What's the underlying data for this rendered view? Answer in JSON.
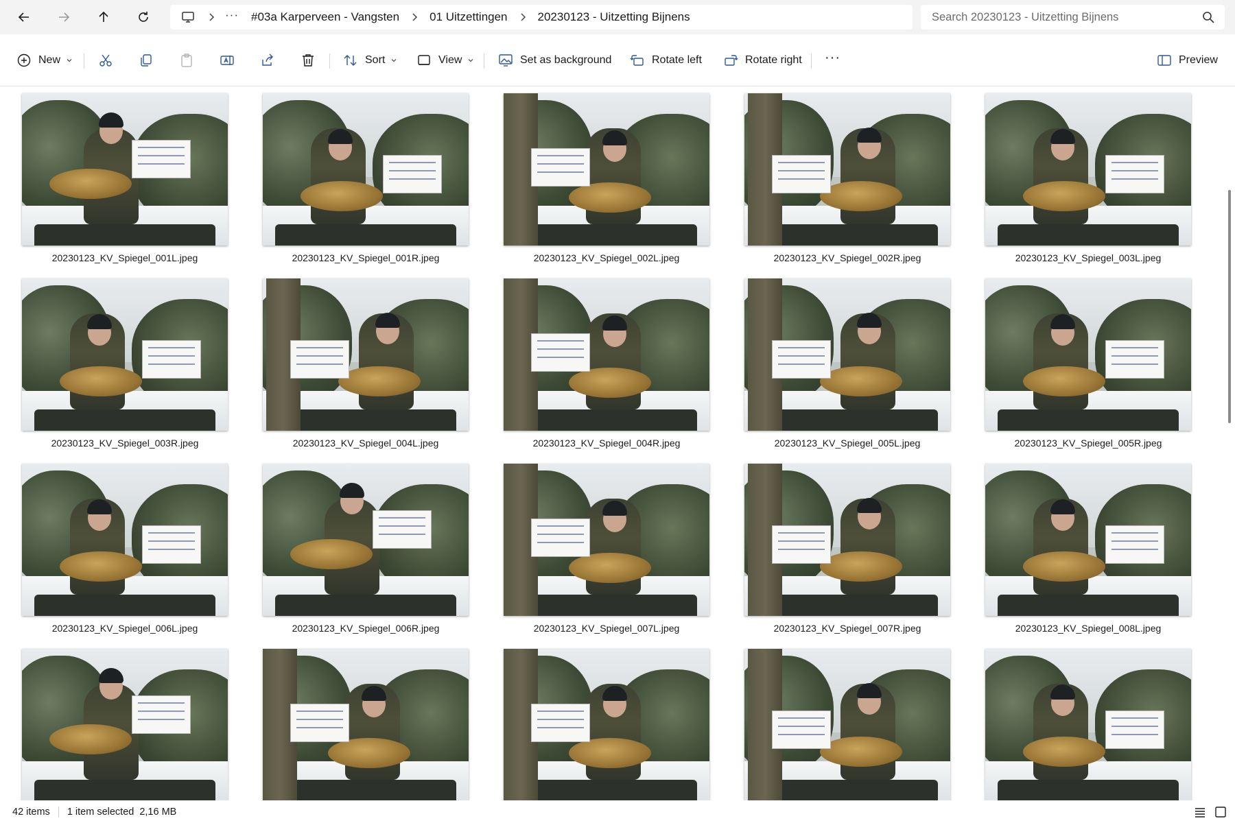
{
  "nav": {
    "back_icon": "back-arrow-icon",
    "forward_icon": "forward-arrow-icon",
    "up_icon": "up-arrow-icon",
    "refresh_icon": "refresh-icon"
  },
  "breadcrumb": {
    "location_icon": "monitor-icon",
    "more": "···",
    "items": [
      "#03a Karperveen - Vangsten",
      "01 Uitzettingen",
      "20230123 - Uitzetting Bijnens"
    ]
  },
  "search": {
    "placeholder": "Search 20230123 - Uitzetting Bijnens"
  },
  "toolbar": {
    "new_label": "New",
    "sort_label": "Sort",
    "view_label": "View",
    "set_background_label": "Set as background",
    "rotate_left_label": "Rotate left",
    "rotate_right_label": "Rotate right",
    "more_label": "···",
    "preview_label": "Preview"
  },
  "files": [
    {
      "name": "20230123_KV_Spiegel_001L.jpeg",
      "variant": "vA"
    },
    {
      "name": "20230123_KV_Spiegel_001R.jpeg",
      "variant": "vB"
    },
    {
      "name": "20230123_KV_Spiegel_002L.jpeg",
      "variant": "vC"
    },
    {
      "name": "20230123_KV_Spiegel_002R.jpeg",
      "variant": "vD"
    },
    {
      "name": "20230123_KV_Spiegel_003L.jpeg",
      "variant": "vB"
    },
    {
      "name": "20230123_KV_Spiegel_003R.jpeg",
      "variant": "vB"
    },
    {
      "name": "20230123_KV_Spiegel_004L.jpeg",
      "variant": "vD"
    },
    {
      "name": "20230123_KV_Spiegel_004R.jpeg",
      "variant": "vC"
    },
    {
      "name": "20230123_KV_Spiegel_005L.jpeg",
      "variant": "vD"
    },
    {
      "name": "20230123_KV_Spiegel_005R.jpeg",
      "variant": "vB"
    },
    {
      "name": "20230123_KV_Spiegel_006L.jpeg",
      "variant": "vB"
    },
    {
      "name": "20230123_KV_Spiegel_006R.jpeg",
      "variant": "vA"
    },
    {
      "name": "20230123_KV_Spiegel_007L.jpeg",
      "variant": "vC"
    },
    {
      "name": "20230123_KV_Spiegel_007R.jpeg",
      "variant": "vD"
    },
    {
      "name": "20230123_KV_Spiegel_008L.jpeg",
      "variant": "vB"
    },
    {
      "name": "",
      "variant": "vA"
    },
    {
      "name": "",
      "variant": "vC"
    },
    {
      "name": "",
      "variant": "vC"
    },
    {
      "name": "",
      "variant": "vD"
    },
    {
      "name": "",
      "variant": "vB"
    }
  ],
  "status": {
    "item_count": "42 items",
    "selection": "1 item selected",
    "size": "2,16 MB"
  },
  "colors": {
    "nav_background": "#f3f3f3",
    "window_background": "#ffffff",
    "icon_stroke": "#1a1a1a",
    "accent": "#2b579a"
  }
}
